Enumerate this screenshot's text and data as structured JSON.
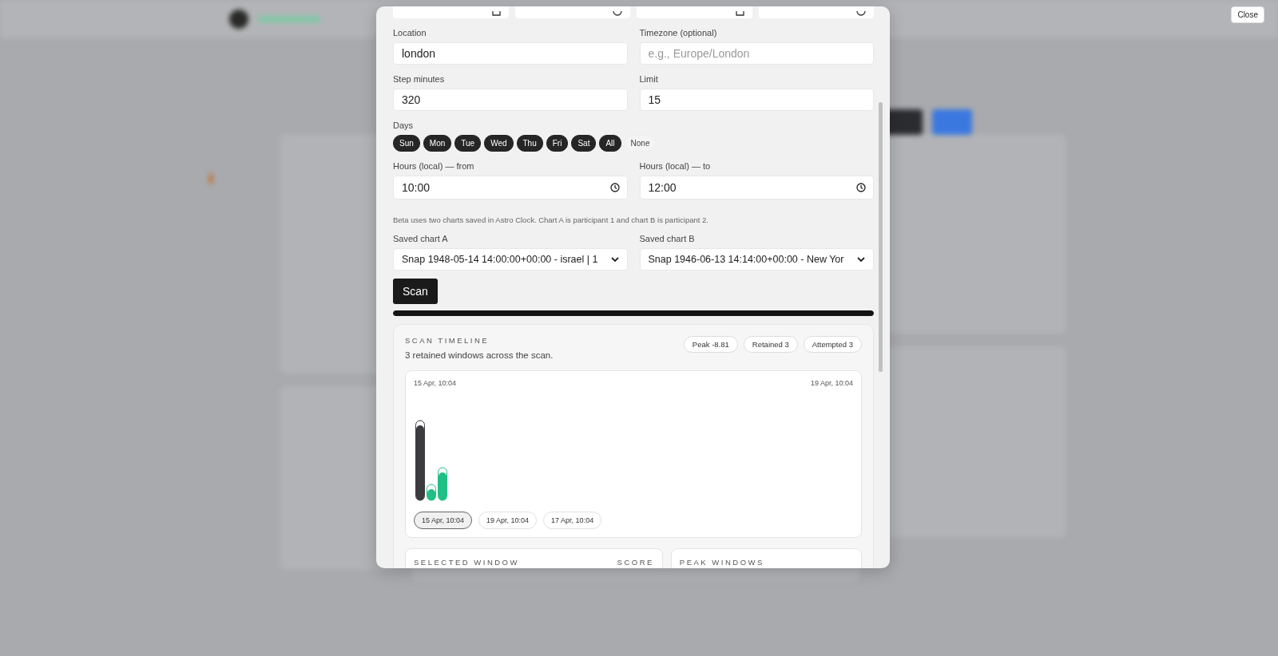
{
  "dialog": {
    "top_fields": [
      {
        "kind": "date"
      },
      {
        "kind": "time"
      },
      {
        "kind": "date"
      },
      {
        "kind": "time"
      }
    ],
    "location": {
      "label": "Location",
      "value": "london"
    },
    "timezone": {
      "label": "Timezone (optional)",
      "placeholder": "e.g., Europe/London"
    },
    "step_minutes": {
      "label": "Step minutes",
      "value": "320"
    },
    "limit": {
      "label": "Limit",
      "value": "15"
    },
    "days": {
      "label": "Days",
      "options": [
        {
          "label": "Sun",
          "selected": true
        },
        {
          "label": "Mon",
          "selected": true
        },
        {
          "label": "Tue",
          "selected": true
        },
        {
          "label": "Wed",
          "selected": true
        },
        {
          "label": "Thu",
          "selected": true
        },
        {
          "label": "Fri",
          "selected": true
        },
        {
          "label": "Sat",
          "selected": true
        },
        {
          "label": "All",
          "selected": true
        },
        {
          "label": "None",
          "selected": false
        }
      ]
    },
    "hours_from": {
      "label": "Hours (local) — from",
      "value": "10:00"
    },
    "hours_to": {
      "label": "Hours (local) — to",
      "value": "12:00"
    },
    "note": "Beta uses two charts saved in Astro Clock. Chart A is participant 1 and chart B is participant 2.",
    "chart_a": {
      "label": "Saved chart A",
      "value": "Snap 1948-05-14 14:00:00+00:00 - israel | 1"
    },
    "chart_b": {
      "label": "Saved chart B",
      "value": "Snap 1946-06-13 14:14:00+00:00 - New Yor"
    },
    "scan_button": "Scan",
    "progress": {
      "level": 1
    },
    "timeline": {
      "title": "SCAN TIMELINE",
      "summary": "3 retained windows across the scan.",
      "badges": [
        "Peak -8.81",
        "Retained 3",
        "Attempted 3"
      ],
      "start_label": "15 Apr, 10:04",
      "end_label": "19 Apr, 10:04",
      "windows": [
        {
          "label": "15 Apr, 10:04",
          "selected": true
        },
        {
          "label": "19 Apr, 10:04",
          "selected": false
        },
        {
          "label": "17 Apr, 10:04",
          "selected": false
        }
      ]
    },
    "selected_window": {
      "title": "SELECTED WINDOW",
      "column": "SCORE"
    },
    "peak_windows": {
      "title": "PEAK WINDOWS"
    }
  },
  "close_button": "Close"
}
